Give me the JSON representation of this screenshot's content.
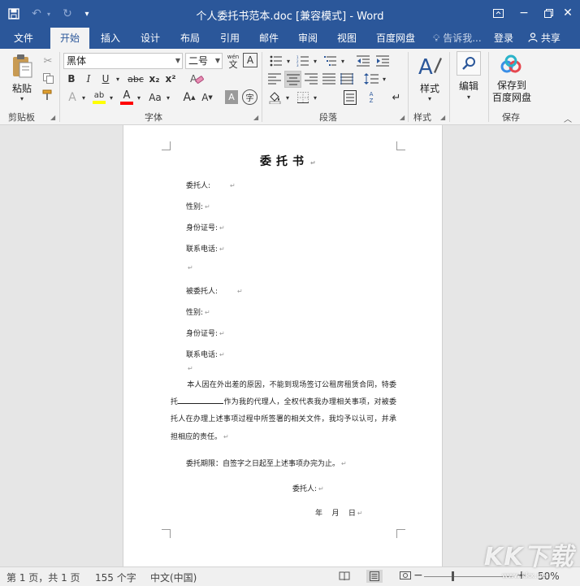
{
  "titlebar": {
    "title": "个人委托书范本.doc [兼容模式] - Word",
    "quick_access": {
      "save": "save-icon",
      "undo": "undo-icon",
      "redo": "redo-icon",
      "customize": "customize-icon"
    },
    "window_controls": {
      "ribbon_options": "ribbon-display-icon",
      "minimize": "minimize-icon",
      "restore": "restore-icon",
      "close": "close-icon"
    }
  },
  "tabs": [
    {
      "label": "文件",
      "active": false
    },
    {
      "label": "开始",
      "active": true
    },
    {
      "label": "插入",
      "active": false
    },
    {
      "label": "设计",
      "active": false
    },
    {
      "label": "布局",
      "active": false
    },
    {
      "label": "引用",
      "active": false
    },
    {
      "label": "邮件",
      "active": false
    },
    {
      "label": "审阅",
      "active": false
    },
    {
      "label": "视图",
      "active": false
    },
    {
      "label": "百度网盘",
      "active": false
    }
  ],
  "tell_me": "告诉我...",
  "login": "登录",
  "share": "共享",
  "ribbon": {
    "clipboard": {
      "label": "剪贴板",
      "paste": "粘贴"
    },
    "font": {
      "label": "字体",
      "font_name": "黑体",
      "font_size": "二号",
      "pinyin": "wén",
      "bold": "B",
      "italic": "I",
      "underline": "U",
      "strikethrough": "abc",
      "subscript": "x₂",
      "superscript": "x²",
      "grow": "A",
      "shrink": "A",
      "case": "Aa",
      "char_shading": "A",
      "enclose": "字"
    },
    "paragraph": {
      "label": "段落"
    },
    "styles": {
      "label": "样式",
      "button": "样式"
    },
    "editing": {
      "button": "编辑"
    },
    "save": {
      "label": "保存",
      "button_line1": "保存到",
      "button_line2": "百度网盘"
    }
  },
  "document": {
    "title": "委托书",
    "principal_label": "委托人:",
    "gender_label": "性别:",
    "id_label": "身份证号:",
    "phone_label": "联系电话:",
    "agent_label": "被委托人:",
    "gender_label2": "性别:",
    "id_label2": "身份证号:",
    "phone_label2": "联系电话:",
    "body_part1": "本人因在外出差的原因，不能到现场签订公租房租赁合同，特委托",
    "body_part2": "作为我的代理人，全权代表我办理相关事项，对被委托人在办理上述事项过程中所签署的相关文件，我均予以认可，并承担相应的责任。",
    "period": "委托期限：自签字之日起至上述事项办完为止。",
    "signature": "委托人:",
    "date": "年    月    日",
    "para_mark": "↵"
  },
  "status": {
    "page": "第 1 页，共 1 页",
    "words": "155 个字",
    "language": "中文(中国)",
    "zoom": "50%",
    "zoom_out": "−",
    "zoom_in": "+"
  },
  "watermark": {
    "logo": "KK下载",
    "url": "www.kkx.net"
  },
  "colors": {
    "accent": "#2b579a",
    "ribbon_bg": "#f3f3f3",
    "highlight": "#ffff00",
    "font_color": "#ff0000"
  }
}
